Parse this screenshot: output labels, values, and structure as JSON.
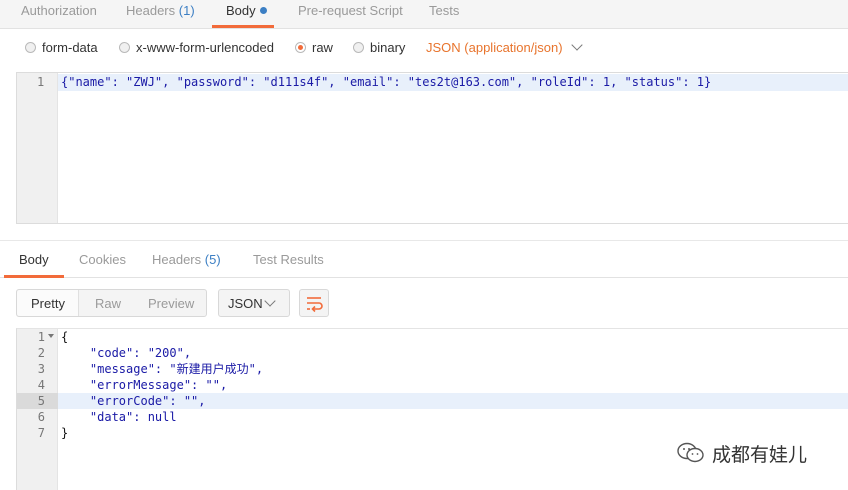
{
  "request_tabs": [
    {
      "label": "Authorization"
    },
    {
      "label": "Headers",
      "count": "(1)"
    },
    {
      "label": "Body"
    },
    {
      "label": "Pre-request Script"
    },
    {
      "label": "Tests"
    }
  ],
  "body_options": {
    "form_data": "form-data",
    "urlencoded": "x-www-form-urlencoded",
    "raw": "raw",
    "binary": "binary",
    "content_type": "JSON (application/json)"
  },
  "request_body": {
    "line_number": "1",
    "text": "{\"name\": \"ZWJ\", \"password\": \"d111s4f\", \"email\": \"tes2t@163.com\", \"roleId\": 1, \"status\": 1}"
  },
  "response_tabs": [
    {
      "label": "Body"
    },
    {
      "label": "Cookies"
    },
    {
      "label": "Headers",
      "count": "(5)"
    },
    {
      "label": "Test Results"
    }
  ],
  "view_modes": {
    "pretty": "Pretty",
    "raw": "Raw",
    "preview": "Preview"
  },
  "format": "JSON",
  "response_lines": [
    {
      "n": "1",
      "text": "{"
    },
    {
      "n": "2",
      "text": "    \"code\": \"200\","
    },
    {
      "n": "3",
      "text": "    \"message\": \"新建用户成功\","
    },
    {
      "n": "4",
      "text": "    \"errorMessage\": \"\","
    },
    {
      "n": "5",
      "text": "    \"errorCode\": \"\","
    },
    {
      "n": "6",
      "text": "    \"data\": null"
    },
    {
      "n": "7",
      "text": "}"
    }
  ],
  "watermark": "成都有娃儿",
  "colors": {
    "accent": "#f26b3a",
    "link": "#3c7fc4",
    "json_type": "#e8742d"
  }
}
